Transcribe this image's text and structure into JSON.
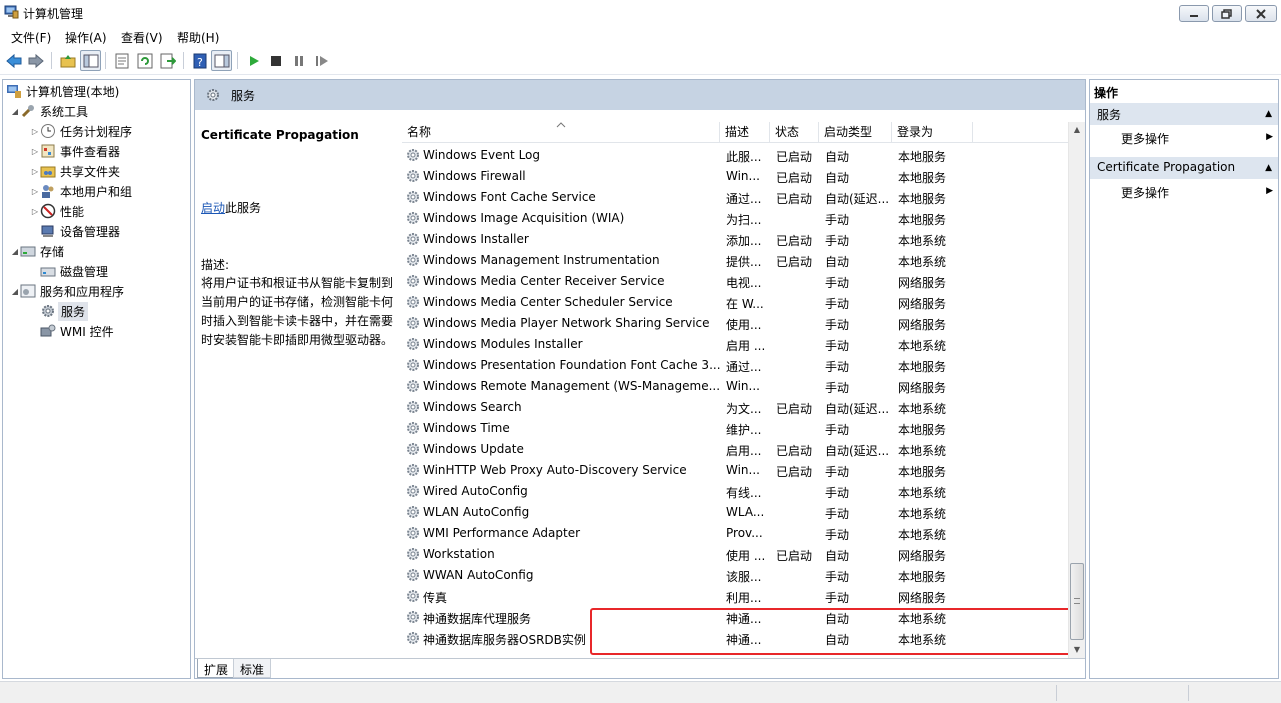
{
  "window": {
    "title": "计算机管理"
  },
  "menu": [
    {
      "label": "文件(F)"
    },
    {
      "label": "操作(A)"
    },
    {
      "label": "查看(V)"
    },
    {
      "label": "帮助(H)"
    }
  ],
  "tree": {
    "items": [
      {
        "label": "计算机管理(本地)",
        "icon": "computer-management-icon"
      },
      {
        "label": "系统工具",
        "icon": "tools-icon"
      },
      {
        "label": "任务计划程序",
        "icon": "clock-icon"
      },
      {
        "label": "事件查看器",
        "icon": "event-viewer-icon"
      },
      {
        "label": "共享文件夹",
        "icon": "shared-folder-icon"
      },
      {
        "label": "本地用户和组",
        "icon": "users-icon"
      },
      {
        "label": "性能",
        "icon": "performance-icon"
      },
      {
        "label": "设备管理器",
        "icon": "device-manager-icon"
      },
      {
        "label": "存储",
        "icon": "storage-icon"
      },
      {
        "label": "磁盘管理",
        "icon": "disk-icon"
      },
      {
        "label": "服务和应用程序",
        "icon": "services-apps-icon"
      },
      {
        "label": "服务",
        "icon": "gear-icon"
      },
      {
        "label": "WMI 控件",
        "icon": "wmi-icon"
      }
    ]
  },
  "center": {
    "header_title": "服务",
    "selected_service": "Certificate Propagation",
    "start_link": "启动",
    "start_suffix": "此服务",
    "desc_label": "描述:",
    "desc_text": "将用户证书和根证书从智能卡复制到当前用户的证书存储，检测智能卡何时插入到智能卡读卡器中，并在需要时安装智能卡即插即用微型驱动器。",
    "columns": [
      "名称",
      "描述",
      "状态",
      "启动类型",
      "登录为"
    ],
    "rows": [
      {
        "name": "Windows Event Log",
        "desc": "此服...",
        "status": "已启动",
        "start": "自动",
        "logon": "本地服务"
      },
      {
        "name": "Windows Firewall",
        "desc": "Win...",
        "status": "已启动",
        "start": "自动",
        "logon": "本地服务"
      },
      {
        "name": "Windows Font Cache Service",
        "desc": "通过...",
        "status": "已启动",
        "start": "自动(延迟...",
        "logon": "本地服务"
      },
      {
        "name": "Windows Image Acquisition (WIA)",
        "desc": "为扫...",
        "status": "",
        "start": "手动",
        "logon": "本地服务"
      },
      {
        "name": "Windows Installer",
        "desc": "添加...",
        "status": "已启动",
        "start": "手动",
        "logon": "本地系统"
      },
      {
        "name": "Windows Management Instrumentation",
        "desc": "提供...",
        "status": "已启动",
        "start": "自动",
        "logon": "本地系统"
      },
      {
        "name": "Windows Media Center Receiver Service",
        "desc": "电视...",
        "status": "",
        "start": "手动",
        "logon": "网络服务"
      },
      {
        "name": "Windows Media Center Scheduler Service",
        "desc": "在 W...",
        "status": "",
        "start": "手动",
        "logon": "网络服务"
      },
      {
        "name": "Windows Media Player Network Sharing Service",
        "desc": "使用...",
        "status": "",
        "start": "手动",
        "logon": "网络服务"
      },
      {
        "name": "Windows Modules Installer",
        "desc": "启用 ...",
        "status": "",
        "start": "手动",
        "logon": "本地系统"
      },
      {
        "name": "Windows Presentation Foundation Font Cache 3...",
        "desc": "通过...",
        "status": "",
        "start": "手动",
        "logon": "本地服务"
      },
      {
        "name": "Windows Remote Management (WS-Manageme...",
        "desc": "Win...",
        "status": "",
        "start": "手动",
        "logon": "网络服务"
      },
      {
        "name": "Windows Search",
        "desc": "为文...",
        "status": "已启动",
        "start": "自动(延迟...",
        "logon": "本地系统"
      },
      {
        "name": "Windows Time",
        "desc": "维护...",
        "status": "",
        "start": "手动",
        "logon": "本地服务"
      },
      {
        "name": "Windows Update",
        "desc": "启用...",
        "status": "已启动",
        "start": "自动(延迟...",
        "logon": "本地系统"
      },
      {
        "name": "WinHTTP Web Proxy Auto-Discovery Service",
        "desc": "Win...",
        "status": "已启动",
        "start": "手动",
        "logon": "本地服务"
      },
      {
        "name": "Wired AutoConfig",
        "desc": "有线...",
        "status": "",
        "start": "手动",
        "logon": "本地系统"
      },
      {
        "name": "WLAN AutoConfig",
        "desc": "WLA...",
        "status": "",
        "start": "手动",
        "logon": "本地系统"
      },
      {
        "name": "WMI Performance Adapter",
        "desc": "Prov...",
        "status": "",
        "start": "手动",
        "logon": "本地系统"
      },
      {
        "name": "Workstation",
        "desc": "使用 ...",
        "status": "已启动",
        "start": "自动",
        "logon": "网络服务"
      },
      {
        "name": "WWAN AutoConfig",
        "desc": "该服...",
        "status": "",
        "start": "手动",
        "logon": "本地服务"
      },
      {
        "name": "传真",
        "desc": "利用...",
        "status": "",
        "start": "手动",
        "logon": "网络服务"
      },
      {
        "name": "神通数据库代理服务",
        "desc": "神通...",
        "status": "",
        "start": "自动",
        "logon": "本地系统"
      },
      {
        "name": "神通数据库服务器OSRDB实例",
        "desc": "神通...",
        "status": "",
        "start": "自动",
        "logon": "本地系统"
      }
    ],
    "tabs": [
      "扩展",
      "标准"
    ],
    "highlight_color": "#e8272a"
  },
  "actions": {
    "title": "操作",
    "groups": [
      {
        "label": "服务",
        "item": "更多操作"
      },
      {
        "label": "Certificate Propagation",
        "item": "更多操作"
      }
    ]
  },
  "colors": {
    "header_bg": "#c6d3e3",
    "group_bg": "#dde5ef",
    "link": "#1c57b5"
  }
}
